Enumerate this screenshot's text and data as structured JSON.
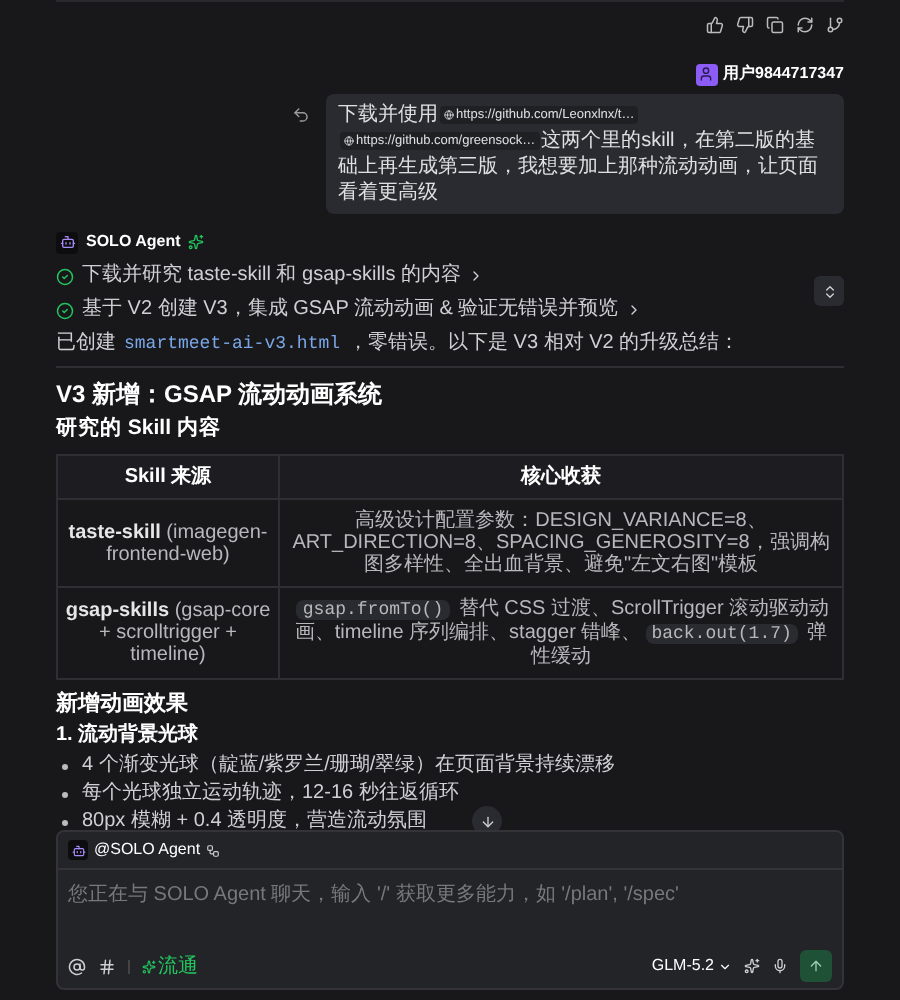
{
  "user": {
    "name": "用户9844717347"
  },
  "message": {
    "parts": [
      {
        "kind": "text",
        "text": "下载并使用"
      },
      {
        "kind": "link",
        "text": "https://github.com/Leonxlnx/t…"
      },
      {
        "kind": "link",
        "text": "https://github.com/greensock…"
      },
      {
        "kind": "text",
        "text": "这两个里的skill，在第二版的基础上再生成第三版，我想要加上那种流动动画，让页面看着更高级"
      }
    ]
  },
  "agent": {
    "name": "SOLO Agent"
  },
  "steps": [
    {
      "text": "下载并研究 taste-skill 和 gsap-skills 的内容",
      "done": true
    },
    {
      "text": "基于 V2 创建 V3，集成 GSAP 流动动画 & 验证无错误并预览",
      "done": true
    }
  ],
  "summary": [
    {
      "kind": "text",
      "text": "已创建"
    },
    {
      "kind": "code",
      "text": "smartmeet-ai-v3.html"
    },
    {
      "kind": "text",
      "text": "，零错误。以下是 V3 相对 V2 的升级总结："
    }
  ],
  "heading": "V3 新增：GSAP 流动动画系统",
  "subheading": "研究的 Skill 内容",
  "table": {
    "columns": [
      "Skill 来源",
      "核心收获"
    ],
    "rows": [
      [
        [
          {
            "kind": "bold",
            "text": "taste-skill"
          },
          {
            "kind": "text",
            "text": " (imagegen-frontend-web)"
          }
        ],
        [
          {
            "kind": "text",
            "text": "高级设计配置参数：DESIGN_VARIANCE=8、ART_DIRECTION=8、SPACING_GENEROSITY=8，强调构图多样性、全出血背景、避免\"左文右图\"模板"
          }
        ]
      ],
      [
        [
          {
            "kind": "bold",
            "text": "gsap-skills"
          },
          {
            "kind": "text",
            "text": " (gsap-core + scrolltrigger + timeline)"
          }
        ],
        [
          {
            "kind": "code",
            "text": "gsap.fromTo()"
          },
          {
            "kind": "text",
            "text": " 替代 CSS 过渡、ScrollTrigger 滚动驱动动画、timeline 序列编排、stagger 错峰、"
          },
          {
            "kind": "code",
            "text": "back.out(1.7)"
          },
          {
            "kind": "text",
            "text": " 弹性缓动"
          }
        ]
      ]
    ]
  },
  "section": "新增动画效果",
  "subsection": "1. 流动背景光球",
  "bullets": [
    "4 个渐变光球（靛蓝/紫罗兰/珊瑚/翠绿）在页面背景持续漂移",
    "每个光球独立运动轨迹，12-16 秒往返循环",
    "80px 模糊 + 0.4 透明度，营造流动氛围"
  ],
  "composer": {
    "mention": "@SOLO Agent",
    "placeholder": "您正在与 SOLO Agent 聊天，输入 '/' 获取更多能力，如 '/plan', '/spec'",
    "mode": "流通",
    "model": "GLM-5.2"
  }
}
